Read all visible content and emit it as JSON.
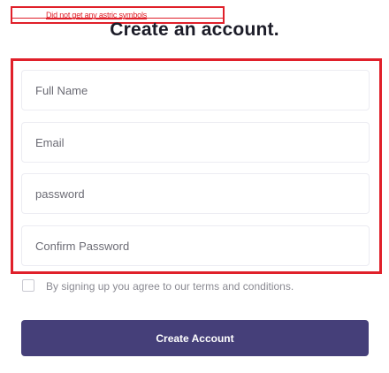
{
  "annotation": {
    "note": "Did not get any astric symbols"
  },
  "header": {
    "title": "Create an account."
  },
  "form": {
    "full_name": {
      "placeholder": "Full Name",
      "value": ""
    },
    "email": {
      "placeholder": "Email",
      "value": ""
    },
    "password": {
      "placeholder": "password",
      "value": ""
    },
    "confirm_password": {
      "placeholder": "Confirm Password",
      "value": ""
    },
    "terms": {
      "checked": false,
      "label": "By signing up you agree to our terms and conditions."
    },
    "submit_label": "Create Account"
  },
  "colors": {
    "annotation": "#e0202a",
    "button": "#453f79",
    "title": "#1c1c28"
  }
}
